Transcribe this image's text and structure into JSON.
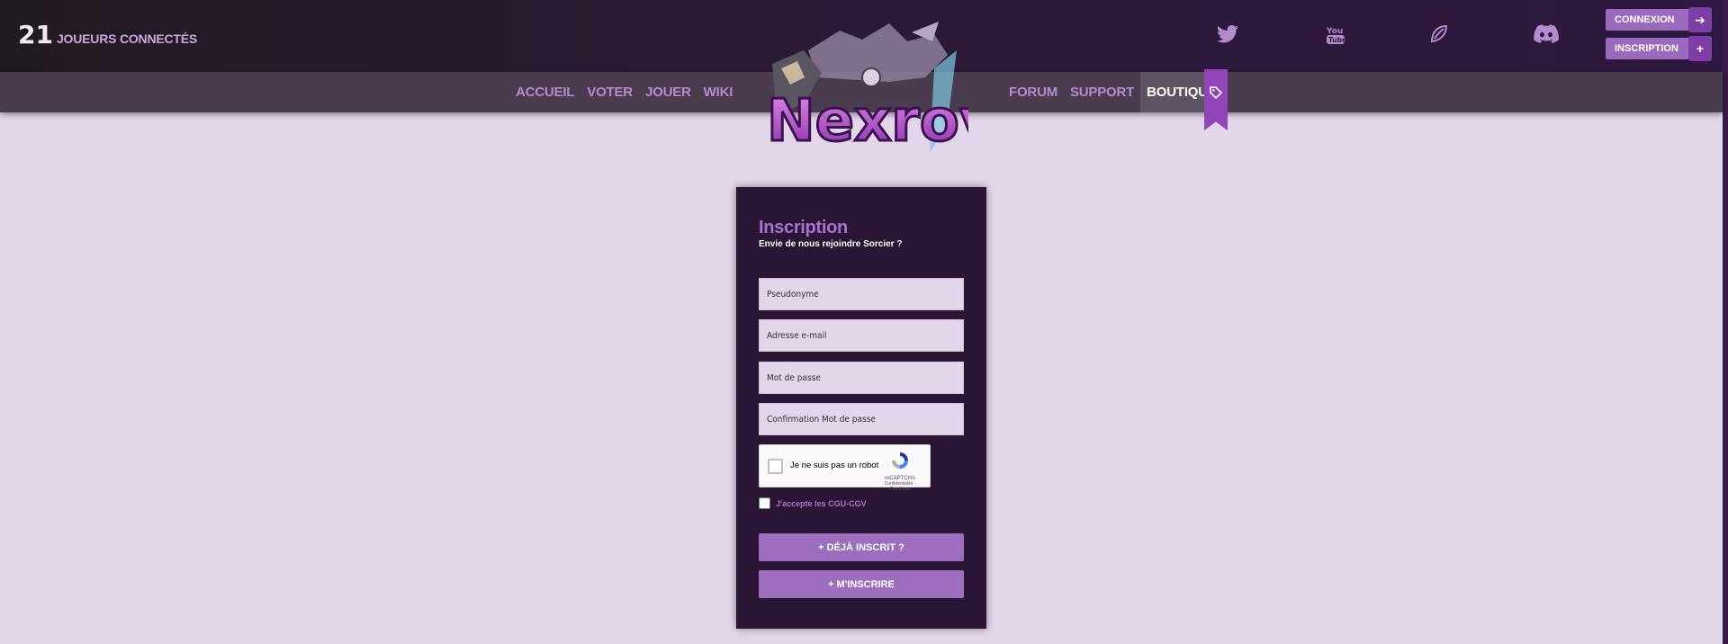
{
  "header": {
    "online_count": "21",
    "online_label": "JOUEURS CONNECTÉS",
    "social": [
      "twitter-icon",
      "youtube-icon",
      "feather-icon",
      "discord-icon"
    ],
    "login_label": "CONNEXION",
    "register_label": "INSCRIPTION"
  },
  "nav": {
    "left": [
      "ACCUEIL",
      "VOTER",
      "JOUER",
      "WIKI"
    ],
    "right": [
      "FORUM",
      "SUPPORT",
      "BOUTIQUE"
    ],
    "active": "BOUTIQUE"
  },
  "logo": {
    "text": "Nexrov"
  },
  "form": {
    "title": "Inscription",
    "subtitle": "Envie de nous rejoindre Sorcier ?",
    "placeholders": {
      "username": "Pseudonyme",
      "email": "Adresse e-mail",
      "password": "Mot de passe",
      "confirm": "Confirmation Mot de passe"
    },
    "captcha": {
      "label": "Je ne suis pas un robot",
      "brand": "reCAPTCHA",
      "links": "Confidentialité - Conditions"
    },
    "cgu_label": "J'accepte les CGU-CGV",
    "already_label": "+ DÉJÀ INSCRIT ?",
    "submit_label": "+ M'INSCRIRE"
  },
  "colors": {
    "accent": "#9d6dbe",
    "page_bg": "#e3d6ea",
    "card_bg": "#2b1535",
    "nav_bg": "#4a3c4e"
  }
}
